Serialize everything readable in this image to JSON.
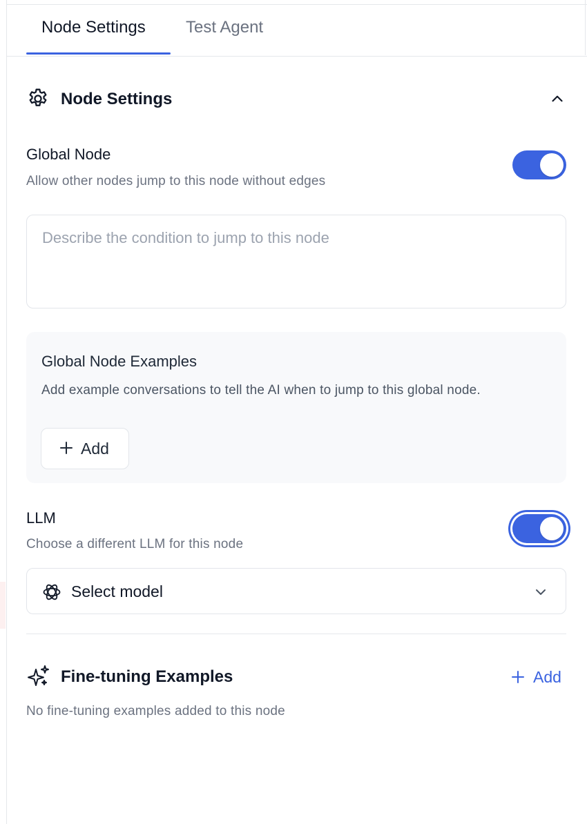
{
  "tabs": [
    {
      "label": "Node Settings",
      "active": true
    },
    {
      "label": "Test Agent",
      "active": false
    }
  ],
  "section": {
    "title": "Node Settings",
    "icon": "gear-icon",
    "collapse_icon": "chevron-up-icon"
  },
  "global_node": {
    "label": "Global Node",
    "description": "Allow other nodes jump to this node without edges",
    "enabled": true,
    "condition_placeholder": "Describe the condition to jump to this node",
    "condition_value": ""
  },
  "examples": {
    "title": "Global Node Examples",
    "description": "Add example conversations to tell the AI when to jump to this global node.",
    "add_label": "Add"
  },
  "llm": {
    "label": "LLM",
    "description": "Choose a different LLM for this node",
    "enabled": true,
    "select_value": "Select model",
    "model_icon": "openai-icon"
  },
  "fine_tuning": {
    "title": "Fine-tuning Examples",
    "icon": "sparkle-icon",
    "add_label": "Add",
    "empty_text": "No fine-tuning examples added to this node"
  },
  "colors": {
    "accent": "#3b63e0",
    "muted": "#6b7280",
    "border": "#e2e5ea",
    "panel": "#f8f9fb"
  }
}
